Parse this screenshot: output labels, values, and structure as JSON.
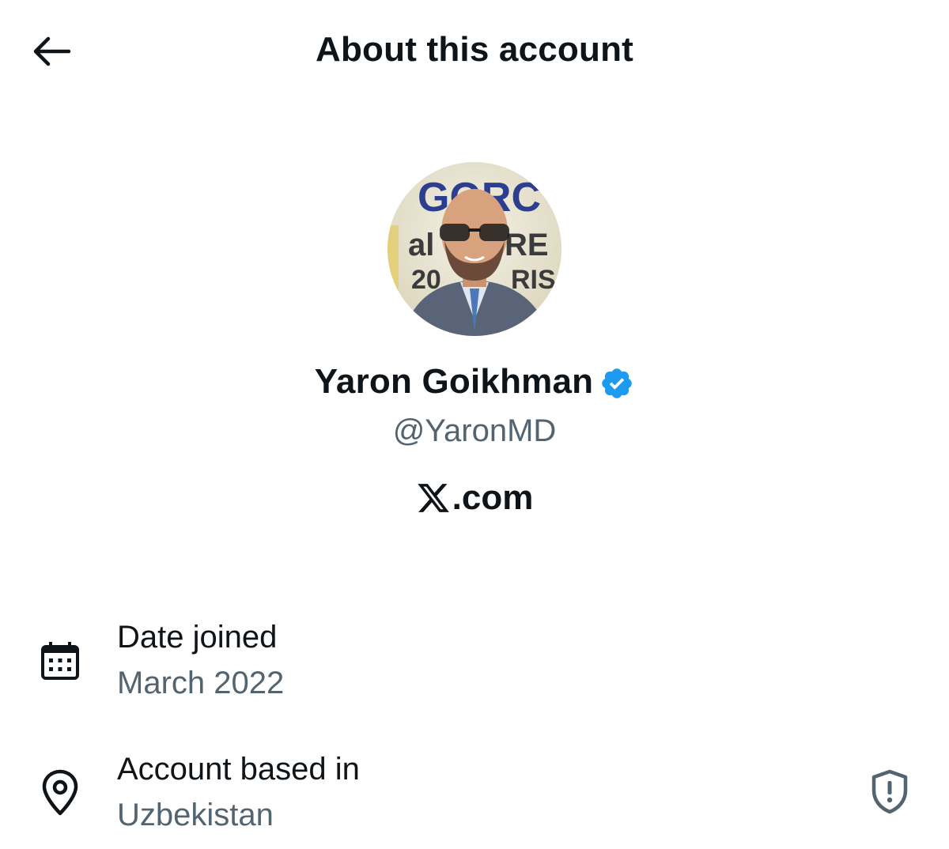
{
  "header": {
    "title": "About this account",
    "back_icon": "arrow-left-icon"
  },
  "profile": {
    "avatar_alt": "profile photo",
    "display_name": "Yaron Goikhman",
    "verified": true,
    "verified_color": "#1d9bf0",
    "handle": "@YaronMD",
    "source_prefix_icon": "x-logo-icon",
    "source_text": ".com"
  },
  "details": [
    {
      "icon": "calendar-icon",
      "label": "Date joined",
      "value": "March 2022"
    },
    {
      "icon": "location-pin-icon",
      "label": "Account based in",
      "value": "Uzbekistan",
      "action_icon": "shield-alert-icon"
    }
  ],
  "colors": {
    "primary_text": "#0f1419",
    "secondary_text": "#536471",
    "accent": "#1d9bf0"
  }
}
